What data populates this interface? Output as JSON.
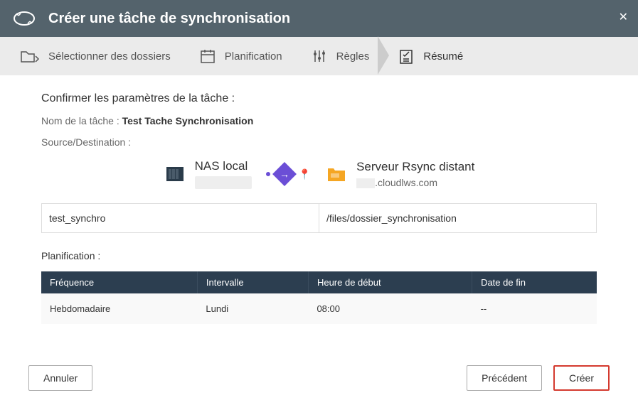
{
  "header": {
    "title": "Créer une tâche de synchronisation"
  },
  "steps": {
    "select_folders": "Sélectionner des dossiers",
    "schedule": "Planification",
    "rules": "Règles",
    "summary": "Résumé"
  },
  "summary": {
    "confirm_title": "Confirmer les paramètres de la tâche :",
    "task_name_label": "Nom de la tâche : ",
    "task_name_value": "Test Tache Synchronisation",
    "source_dest_label": "Source/Destination :",
    "local_nas": {
      "title": "NAS local"
    },
    "remote": {
      "title": "Serveur Rsync distant",
      "host_suffix": ".cloudlws.com"
    },
    "source_path": "test_synchro",
    "dest_path": "/files/dossier_synchronisation",
    "sched_label": "Planification :",
    "sched_headers": {
      "frequency": "Fréquence",
      "interval": "Intervalle",
      "start_time": "Heure de début",
      "end_date": "Date de fin"
    },
    "sched_row": {
      "frequency": "Hebdomadaire",
      "interval": "Lundi",
      "start_time": "08:00",
      "end_date": "--"
    }
  },
  "footer": {
    "cancel": "Annuler",
    "previous": "Précédent",
    "create": "Créer"
  }
}
